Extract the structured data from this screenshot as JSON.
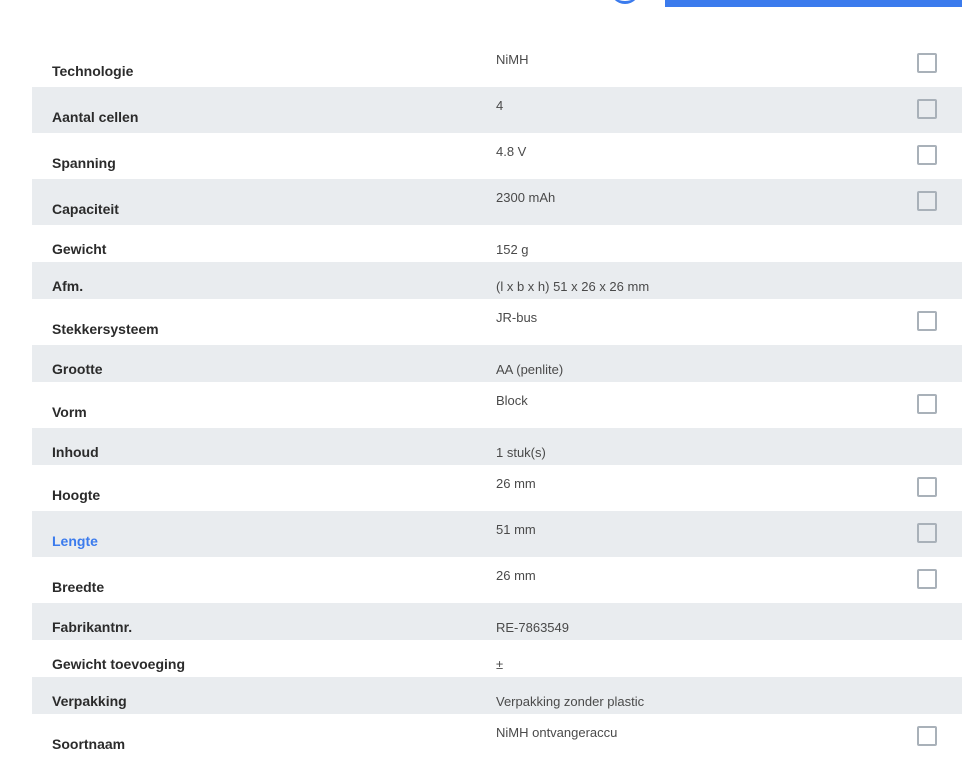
{
  "accent_color": "#3b7bed",
  "row_alt_color": "#e9ecef",
  "specs": [
    {
      "label": "Technologie",
      "value": "NiMH",
      "checkbox": true
    },
    {
      "label": "Aantal cellen",
      "value": "4",
      "checkbox": true
    },
    {
      "label": "Spanning",
      "value": "4.8 V",
      "checkbox": true
    },
    {
      "label": "Capaciteit",
      "value": "2300 mAh",
      "checkbox": true
    },
    {
      "label": "Gewicht",
      "value": "152 g",
      "checkbox": false
    },
    {
      "label": "Afm.",
      "value": "(l x b x h) 51 x 26 x 26 mm",
      "checkbox": false
    },
    {
      "label": "Stekkersysteem",
      "value": "JR-bus",
      "checkbox": true
    },
    {
      "label": "Grootte",
      "value": "AA (penlite)",
      "checkbox": false
    },
    {
      "label": "Vorm",
      "value": "Block",
      "checkbox": true
    },
    {
      "label": "Inhoud",
      "value": "1 stuk(s)",
      "checkbox": false
    },
    {
      "label": "Hoogte",
      "value": "26 mm",
      "checkbox": true
    },
    {
      "label": "Lengte",
      "value": "51 mm",
      "checkbox": true,
      "highlighted": true
    },
    {
      "label": "Breedte",
      "value": "26 mm",
      "checkbox": true
    },
    {
      "label": "Fabrikantnr.",
      "value": "RE-7863549",
      "checkbox": false
    },
    {
      "label": "Gewicht toevoeging",
      "value": "±",
      "checkbox": false
    },
    {
      "label": "Verpakking",
      "value": "Verpakking zonder plastic",
      "checkbox": false
    },
    {
      "label": "Soortnaam",
      "value": "NiMH ontvangeraccu",
      "checkbox": true
    }
  ]
}
